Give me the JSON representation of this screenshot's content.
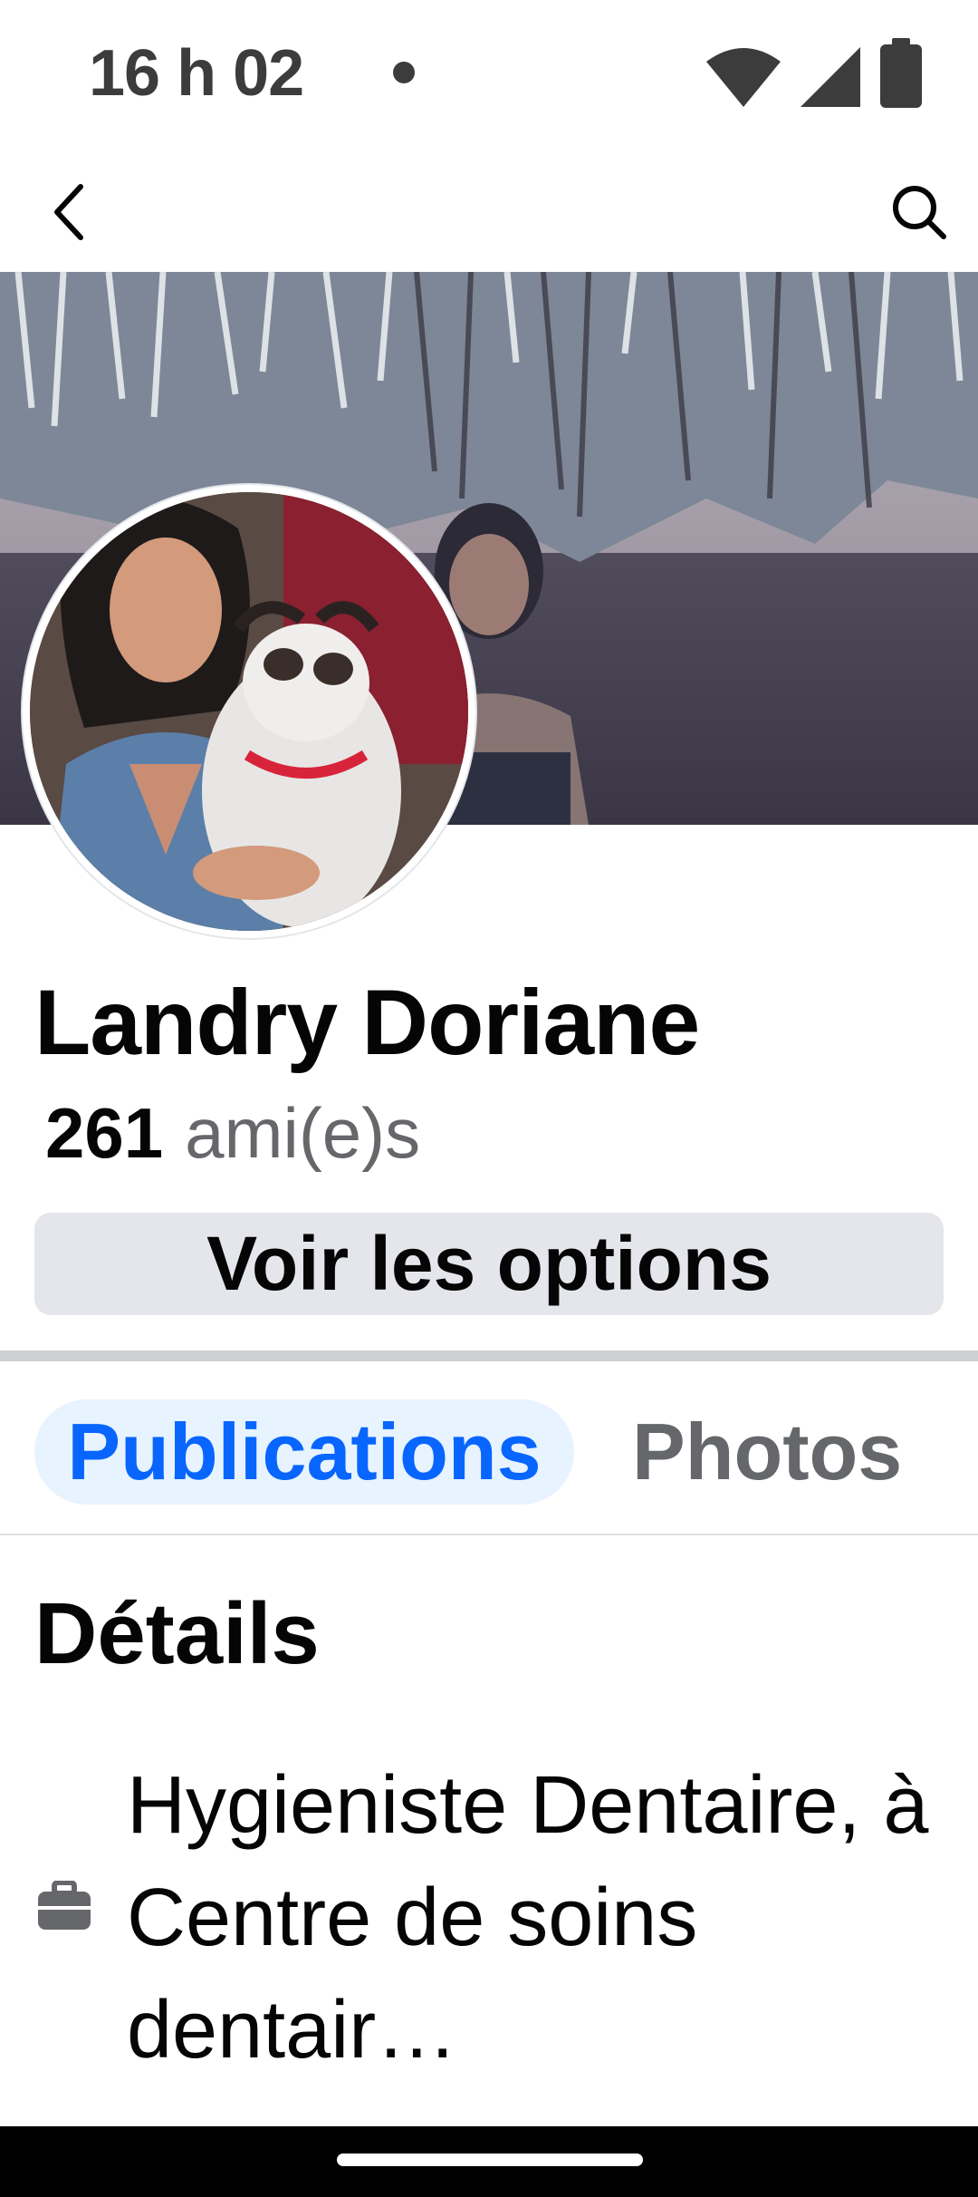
{
  "status_bar": {
    "time": "16 h 02",
    "icons": [
      "wifi-icon",
      "cellular-signal-icon",
      "battery-icon"
    ]
  },
  "top_nav": {
    "icons": [
      "back-arrow-icon",
      "search-icon"
    ]
  },
  "profile": {
    "name": "Landry Doriane",
    "friends_count": "261",
    "friends_label": "ami(e)s",
    "options_button": "Voir les options"
  },
  "tabs": [
    {
      "label": "Publications",
      "active": true
    },
    {
      "label": "Photos",
      "active": false
    }
  ],
  "details": {
    "title": "Détails",
    "work": {
      "icon": "briefcase-icon",
      "text": "Hygieniste Dentaire, à Centre de soins dentair…"
    }
  },
  "colors": {
    "accent": "#0866ff",
    "active_tab_bg": "#e7f3ff",
    "button_bg": "#e4e6eb",
    "secondary_text": "#65676b"
  }
}
